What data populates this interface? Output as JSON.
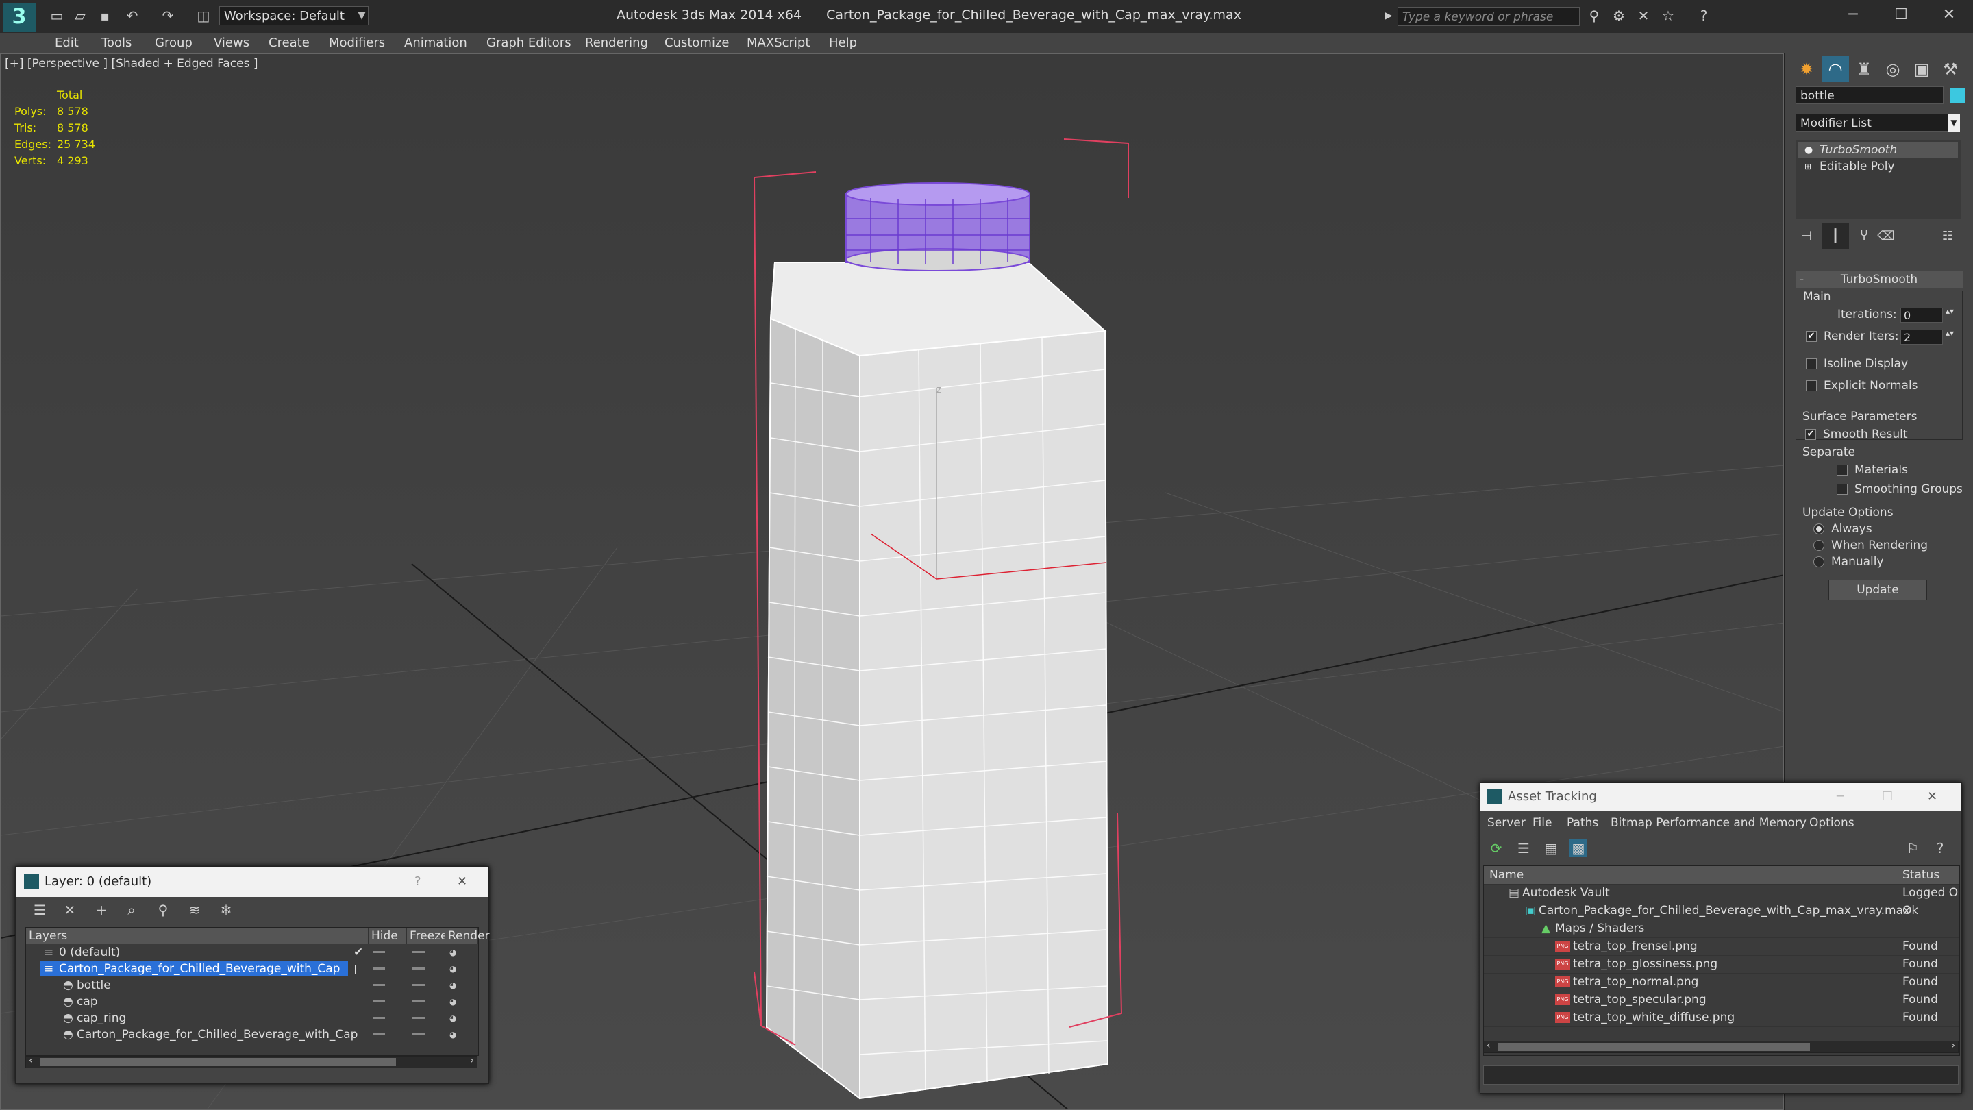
{
  "titlebar": {
    "workspace": "Workspace: Default",
    "app_name": "Autodesk 3ds Max  2014 x64",
    "file_name": "Carton_Package_for_Chilled_Beverage_with_Cap_max_vray.max",
    "search_placeholder": "Type a keyword or phrase"
  },
  "menu": [
    "Edit",
    "Tools",
    "Group",
    "Views",
    "Create",
    "Modifiers",
    "Animation",
    "Graph Editors",
    "Rendering",
    "Customize",
    "MAXScript",
    "Help"
  ],
  "viewport": {
    "label": "[+] [Perspective ] [Shaded + Edged Faces ]",
    "stats": {
      "header": "Total",
      "rows": [
        {
          "label": "Polys:",
          "value": "8 578"
        },
        {
          "label": "Tris:",
          "value": "8 578"
        },
        {
          "label": "Edges:",
          "value": "25 734"
        },
        {
          "label": "Verts:",
          "value": "4 293"
        }
      ]
    },
    "axis_label": "z"
  },
  "command_panel": {
    "object_name": "bottle",
    "object_color": "#3cc8e0",
    "modifier_list": "Modifier List",
    "stack": [
      "TurboSmooth",
      "Editable Poly"
    ],
    "rollout_title": "TurboSmooth",
    "main": {
      "title": "Main",
      "iterations_label": "Iterations:",
      "iterations_value": "0",
      "render_iters_label": "Render Iters:",
      "render_iters_value": "2",
      "isoline_label": "Isoline Display",
      "explicit_label": "Explicit Normals"
    },
    "surface": {
      "title": "Surface Parameters",
      "smooth_label": "Smooth Result",
      "separate_label": "Separate",
      "materials_label": "Materials",
      "smoothing_label": "Smoothing Groups"
    },
    "update": {
      "title": "Update Options",
      "always": "Always",
      "when_rendering": "When Rendering",
      "manually": "Manually",
      "button": "Update"
    }
  },
  "layer_dialog": {
    "title": "Layer: 0 (default)",
    "help": "?",
    "columns": [
      "Layers",
      "Hide",
      "Freeze",
      "Render"
    ],
    "rows": [
      {
        "name": "0 (default)",
        "indent": 1,
        "selected": false
      },
      {
        "name": "Carton_Package_for_Chilled_Beverage_with_Cap",
        "indent": 1,
        "selected": true
      },
      {
        "name": "bottle",
        "indent": 2,
        "selected": false
      },
      {
        "name": "cap",
        "indent": 2,
        "selected": false
      },
      {
        "name": "cap_ring",
        "indent": 2,
        "selected": false
      },
      {
        "name": "Carton_Package_for_Chilled_Beverage_with_Cap",
        "indent": 2,
        "selected": false
      }
    ]
  },
  "asset_dialog": {
    "title": "Asset Tracking",
    "menu": [
      "Server",
      "File",
      "Paths",
      "Bitmap Performance and Memory",
      "Options"
    ],
    "columns": [
      "Name",
      "Status"
    ],
    "rows": [
      {
        "name": "Autodesk Vault",
        "status": "Logged O",
        "level": 1
      },
      {
        "name": "Carton_Package_for_Chilled_Beverage_with_Cap_max_vray.max",
        "status": "Ok",
        "level": 2
      },
      {
        "name": "Maps / Shaders",
        "status": "",
        "level": 3
      },
      {
        "name": "tetra_top_frensel.png",
        "status": "Found",
        "level": 4
      },
      {
        "name": "tetra_top_glossiness.png",
        "status": "Found",
        "level": 4
      },
      {
        "name": "tetra_top_normal.png",
        "status": "Found",
        "level": 4
      },
      {
        "name": "tetra_top_specular.png",
        "status": "Found",
        "level": 4
      },
      {
        "name": "tetra_top_white_diffuse.png",
        "status": "Found",
        "level": 4
      }
    ]
  }
}
